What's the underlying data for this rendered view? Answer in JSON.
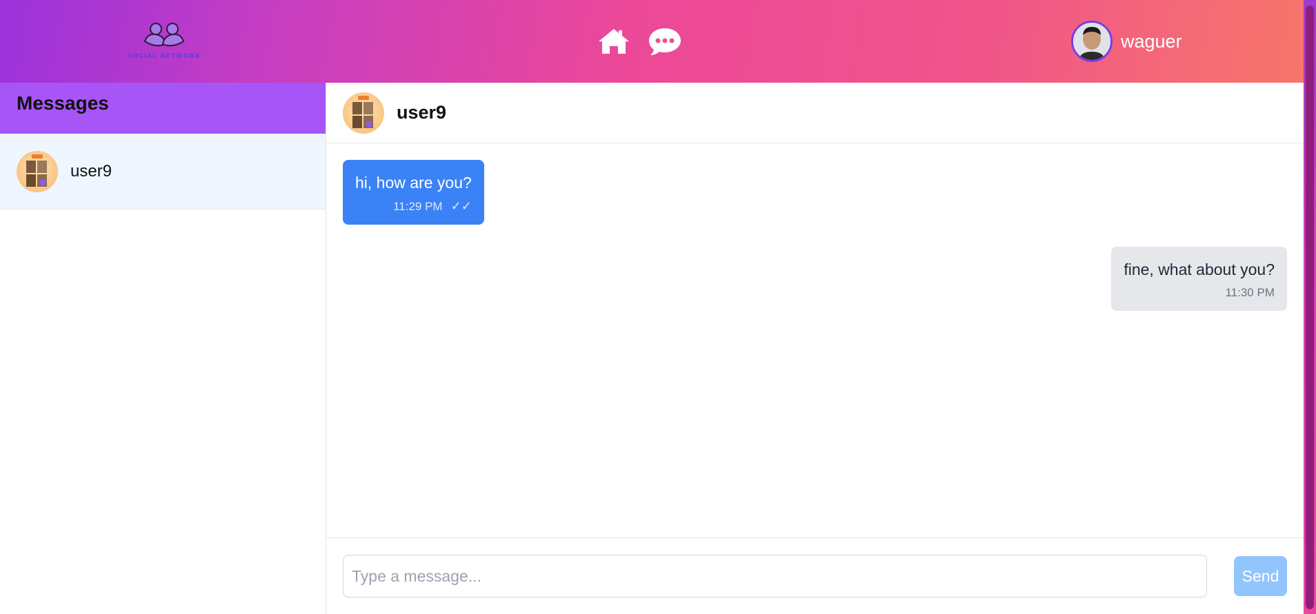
{
  "header": {
    "logo_text": "SOCIAL NETWORK",
    "nav": [
      {
        "icon": "home-icon"
      },
      {
        "icon": "chat-bubble-icon"
      }
    ],
    "user": {
      "name": "waguer"
    }
  },
  "sidebar": {
    "title": "Messages",
    "conversations": [
      {
        "name": "user9",
        "active": true
      }
    ]
  },
  "chat": {
    "contact": "user9",
    "messages": [
      {
        "text": "hi, how are you?",
        "time": "11:29 PM",
        "status": "✓✓",
        "direction": "outgoing"
      },
      {
        "text": "fine, what about you?",
        "time": "11:30 PM",
        "direction": "incoming"
      }
    ],
    "composer": {
      "placeholder": "Type a message...",
      "send_label": "Send"
    }
  },
  "colors": {
    "accent": "#a855f7",
    "outgoing_bubble": "#3b82f6",
    "incoming_bubble": "#e5e7eb",
    "send_button": "#93c5fd"
  }
}
